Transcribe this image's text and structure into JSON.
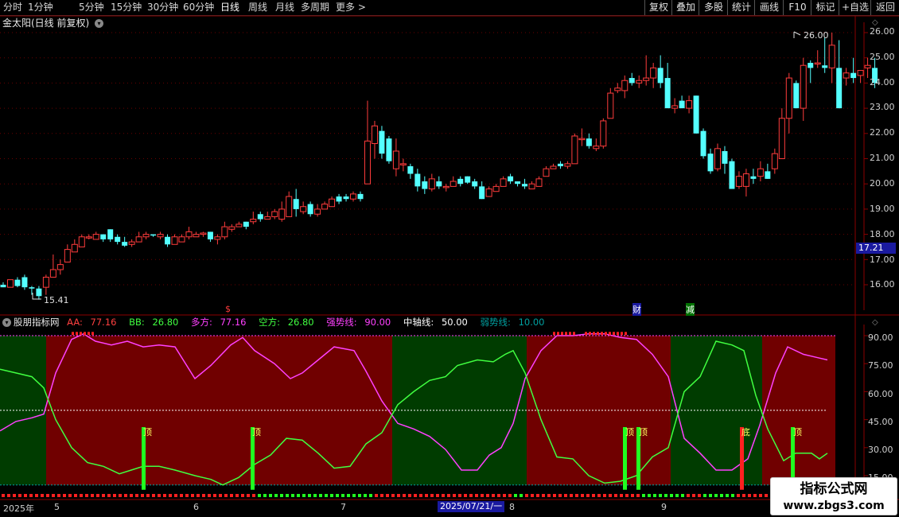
{
  "toolbar": {
    "periods": [
      "分时",
      "1分钟",
      "5分钟",
      "15分钟",
      "30分钟",
      "60分钟",
      "日线",
      "周线",
      "月线",
      "多周期",
      "更多"
    ],
    "active_period": "日线",
    "more_arrow": ">",
    "right_buttons": [
      "复权",
      "叠加",
      "多股",
      "统计",
      "画线",
      "F10",
      "标记",
      "+自选",
      "返回"
    ]
  },
  "main_chart": {
    "title": "金太阳(日线 前复权)",
    "price_axis": [
      "26.00",
      "25.00",
      "24.00",
      "23.00",
      "22.00",
      "21.00",
      "20.00",
      "19.00",
      "18.00",
      "17.00",
      "16.00"
    ],
    "current_price": "17.21",
    "high_label": "26.00",
    "low_label": "15.41",
    "event_markers": [
      "$",
      "财",
      "减"
    ]
  },
  "indicator": {
    "name": "股朋指标网",
    "legend": [
      {
        "label": "AA:",
        "value": "77.16",
        "color": "#ff4040"
      },
      {
        "label": "BB:",
        "value": "26.80",
        "color": "#40ff40"
      },
      {
        "label": "多方:",
        "value": "77.16",
        "color": "#ff40ff"
      },
      {
        "label": "空方:",
        "value": "26.80",
        "color": "#40ff40"
      },
      {
        "label": "强势线:",
        "value": "90.00",
        "color": "#ff40ff"
      },
      {
        "label": "中轴线:",
        "value": "50.00",
        "color": "#ffffff"
      },
      {
        "label": "弱势线:",
        "value": "10.00",
        "color": "#00a0a0"
      }
    ],
    "axis": [
      "90.00",
      "75.00",
      "60.00",
      "45.00",
      "30.00",
      "15.00"
    ],
    "signals": [
      "顶",
      "顶",
      "顶",
      "顶",
      "底",
      "顶"
    ]
  },
  "date_axis": {
    "labels": [
      "2025年",
      "5",
      "6",
      "7",
      "8",
      "9"
    ],
    "selected_date": "2025/07/21/一"
  },
  "watermark": {
    "line1": "指标公式网",
    "line2": "www.zbgs3.com"
  },
  "colors": {
    "up": "#ff3c3c",
    "down": "#54ffff",
    "bull": "#ff40ff",
    "bear": "#40ff40",
    "bg_red": "#700000",
    "bg_green": "#003c00"
  }
}
